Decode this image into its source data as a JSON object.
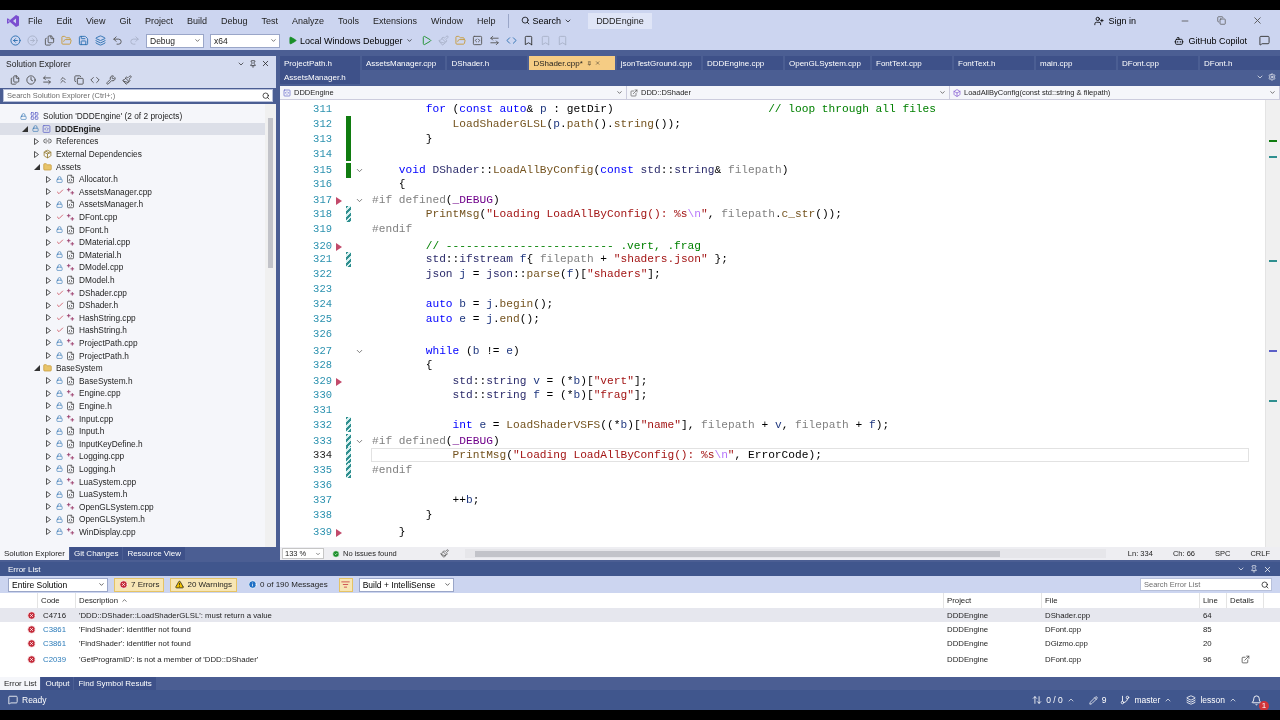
{
  "title_bar": {
    "menu": [
      "File",
      "Edit",
      "View",
      "Git",
      "Project",
      "Build",
      "Debug",
      "Test",
      "Analyze",
      "Tools",
      "Extensions",
      "Window",
      "Help"
    ],
    "search": "Search",
    "project": "DDDEngine",
    "sign_in": "Sign in"
  },
  "toolbar": {
    "configuration": "Debug",
    "platform": "x64",
    "debugger": "Local Windows Debugger",
    "copilot": "GitHub Copilot"
  },
  "solution_explorer": {
    "title": "Solution Explorer",
    "search_placeholder": "Search Solution Explorer (Ctrl+;)",
    "tree": {
      "label": "Solution 'DDDEngine' (2 of 2 projects)",
      "kind": "solution",
      "checked_in": true,
      "selected": false,
      "children": [
        {
          "label": "DDDEngine",
          "kind": "project",
          "checked_in": true,
          "expanded": true,
          "selected": true,
          "children": [
            {
              "label": "References",
              "kind": "references",
              "expanded": false,
              "selected": false
            },
            {
              "label": "External Dependencies",
              "kind": "external",
              "expanded": false,
              "selected": false
            },
            {
              "label": "Assets",
              "kind": "folder",
              "expanded": true,
              "selected": false,
              "children": [
                {
                  "label": "Allocator.h",
                  "kind": "header",
                  "checked_in": true,
                  "expanded": false,
                  "selected": false
                },
                {
                  "label": "AssetsManager.cpp",
                  "kind": "source",
                  "checked_in": false,
                  "expanded": false,
                  "selected": false
                },
                {
                  "label": "AssetsManager.h",
                  "kind": "header",
                  "checked_in": true,
                  "expanded": false,
                  "selected": false
                },
                {
                  "label": "DFont.cpp",
                  "kind": "source",
                  "checked_in": false,
                  "expanded": false,
                  "selected": false
                },
                {
                  "label": "DFont.h",
                  "kind": "header",
                  "checked_in": true,
                  "expanded": false,
                  "selected": false
                },
                {
                  "label": "DMaterial.cpp",
                  "kind": "source",
                  "checked_in": false,
                  "expanded": false,
                  "selected": false
                },
                {
                  "label": "DMaterial.h",
                  "kind": "header",
                  "checked_in": true,
                  "expanded": false,
                  "selected": false
                },
                {
                  "label": "DModel.cpp",
                  "kind": "source",
                  "checked_in": true,
                  "expanded": false,
                  "selected": false
                },
                {
                  "label": "DModel.h",
                  "kind": "header",
                  "checked_in": true,
                  "expanded": false,
                  "selected": false
                },
                {
                  "label": "DShader.cpp",
                  "kind": "source",
                  "checked_in": false,
                  "expanded": false,
                  "selected": false
                },
                {
                  "label": "DShader.h",
                  "kind": "header",
                  "checked_in": false,
                  "expanded": false,
                  "selected": false
                },
                {
                  "label": "HashString.cpp",
                  "kind": "source",
                  "checked_in": false,
                  "expanded": false,
                  "selected": false
                },
                {
                  "label": "HashString.h",
                  "kind": "header",
                  "checked_in": false,
                  "expanded": false,
                  "selected": false
                },
                {
                  "label": "ProjectPath.cpp",
                  "kind": "source",
                  "checked_in": true,
                  "expanded": false,
                  "selected": false
                },
                {
                  "label": "ProjectPath.h",
                  "kind": "header",
                  "checked_in": true,
                  "expanded": false,
                  "selected": false
                }
              ]
            },
            {
              "label": "BaseSystem",
              "kind": "folder",
              "expanded": true,
              "selected": false,
              "children": [
                {
                  "label": "BaseSystem.h",
                  "kind": "header",
                  "checked_in": true,
                  "expanded": false,
                  "selected": false
                },
                {
                  "label": "Engine.cpp",
                  "kind": "source",
                  "checked_in": true,
                  "expanded": false,
                  "selected": false
                },
                {
                  "label": "Engine.h",
                  "kind": "header",
                  "checked_in": true,
                  "expanded": false,
                  "selected": false
                },
                {
                  "label": "Input.cpp",
                  "kind": "source",
                  "checked_in": true,
                  "expanded": false,
                  "selected": false
                },
                {
                  "label": "Input.h",
                  "kind": "header",
                  "checked_in": true,
                  "expanded": false,
                  "selected": false
                },
                {
                  "label": "InputKeyDefine.h",
                  "kind": "header",
                  "checked_in": true,
                  "expanded": false,
                  "selected": false
                },
                {
                  "label": "Logging.cpp",
                  "kind": "source",
                  "checked_in": true,
                  "expanded": false,
                  "selected": false
                },
                {
                  "label": "Logging.h",
                  "kind": "header",
                  "checked_in": true,
                  "expanded": false,
                  "selected": false
                },
                {
                  "label": "LuaSystem.cpp",
                  "kind": "source",
                  "checked_in": true,
                  "expanded": false,
                  "selected": false
                },
                {
                  "label": "LuaSystem.h",
                  "kind": "header",
                  "checked_in": true,
                  "expanded": false,
                  "selected": false
                },
                {
                  "label": "OpenGLSystem.cpp",
                  "kind": "source",
                  "checked_in": true,
                  "expanded": false,
                  "selected": false
                },
                {
                  "label": "OpenGLSystem.h",
                  "kind": "header",
                  "checked_in": true,
                  "expanded": false,
                  "selected": false
                },
                {
                  "label": "WinDisplay.cpp",
                  "kind": "source",
                  "checked_in": true,
                  "expanded": false,
                  "selected": false
                }
              ]
            }
          ]
        }
      ]
    },
    "tabs": [
      {
        "label": "Solution Explorer",
        "selected": true
      },
      {
        "label": "Git Changes",
        "selected": false
      },
      {
        "label": "Resource View",
        "selected": false
      }
    ]
  },
  "editor": {
    "tabs": [
      {
        "label": "ProjectPath.h",
        "selected": false
      },
      {
        "label": "AssetsManager.cpp",
        "selected": false
      },
      {
        "label": "DShader.h",
        "selected": false
      },
      {
        "label": "DShader.cpp*",
        "selected": true
      },
      {
        "label": "jsonTestGround.cpp",
        "selected": false
      },
      {
        "label": "DDDEngine.cpp",
        "selected": false
      },
      {
        "label": "OpenGLSystem.cpp",
        "selected": false
      },
      {
        "label": "FontText.cpp",
        "selected": false
      },
      {
        "label": "FontText.h",
        "selected": false
      },
      {
        "label": "main.cpp",
        "selected": false
      },
      {
        "label": "DFont.cpp",
        "selected": false
      },
      {
        "label": "DFont.h",
        "selected": false
      }
    ],
    "tabs_second_row": [
      {
        "label": "AssetsManager.h",
        "selected": false
      }
    ],
    "navigation": {
      "project": "DDDEngine",
      "scope": "DDD::DShader",
      "member": "LoadAllByConfig(const std::string & filepath)"
    },
    "lines": [
      {
        "number": "311",
        "fold": false,
        "marker": false,
        "current": false,
        "changed": false,
        "segments": [
          {
            "kind": "kw",
            "text": "        for"
          },
          {
            "kind": "plain",
            "text": " ("
          },
          {
            "kind": "kw",
            "text": "const auto"
          },
          {
            "kind": "plain",
            "text": "& "
          },
          {
            "kind": "local",
            "text": "p"
          },
          {
            "kind": "plain",
            "text": " : getDir)                       "
          },
          {
            "kind": "cm",
            "text": "// loop through all files"
          }
        ]
      },
      {
        "number": "312",
        "fold": false,
        "marker": false,
        "current": false,
        "changed": true,
        "saved": true,
        "segments": [
          {
            "kind": "fn",
            "text": "            LoadShaderGLSL"
          },
          {
            "kind": "plain",
            "text": "("
          },
          {
            "kind": "local",
            "text": "p"
          },
          {
            "kind": "plain",
            "text": "."
          },
          {
            "kind": "fn",
            "text": "path"
          },
          {
            "kind": "plain",
            "text": "()."
          },
          {
            "kind": "fn",
            "text": "string"
          },
          {
            "kind": "plain",
            "text": "());"
          }
        ]
      },
      {
        "number": "313",
        "fold": false,
        "marker": false,
        "current": false,
        "changed": true,
        "saved": true,
        "segments": [
          {
            "kind": "plain",
            "text": "        }"
          }
        ]
      },
      {
        "number": "314",
        "fold": false,
        "marker": false,
        "current": false,
        "changed": true,
        "saved": true
      },
      {
        "number": "315",
        "fold": true,
        "marker": false,
        "current": false,
        "changed": true,
        "saved": true,
        "segments": [
          {
            "kind": "kw",
            "text": "    void"
          },
          {
            "kind": "type",
            "text": " DShader"
          },
          {
            "kind": "plain",
            "text": "::"
          },
          {
            "kind": "fn",
            "text": "LoadAllByConfig"
          },
          {
            "kind": "plain",
            "text": "("
          },
          {
            "kind": "kw",
            "text": "const"
          },
          {
            "kind": "type",
            "text": " std"
          },
          {
            "kind": "plain",
            "text": "::"
          },
          {
            "kind": "type",
            "text": "string"
          },
          {
            "kind": "plain",
            "text": "& "
          },
          {
            "kind": "param",
            "text": "filepath"
          },
          {
            "kind": "plain",
            "text": ")"
          }
        ]
      },
      {
        "number": "316",
        "fold": false,
        "marker": false,
        "current": false,
        "changed": false,
        "segments": [
          {
            "kind": "plain",
            "text": "    {"
          }
        ]
      },
      {
        "number": "317",
        "fold": true,
        "marker": true,
        "current": false,
        "changed": false,
        "segments": [
          {
            "kind": "pp",
            "text": "#if defined"
          },
          {
            "kind": "plain",
            "text": "("
          },
          {
            "kind": "macro",
            "text": "_DEBUG"
          },
          {
            "kind": "plain",
            "text": ")"
          }
        ]
      },
      {
        "number": "318",
        "fold": false,
        "marker": false,
        "current": false,
        "changed": true,
        "saved": false,
        "segments": [
          {
            "kind": "fn",
            "text": "        PrintMsg"
          },
          {
            "kind": "plain",
            "text": "("
          },
          {
            "kind": "str",
            "text": "\"Loading LoadAllByConfig(): %s"
          },
          {
            "kind": "esc",
            "text": "\\n"
          },
          {
            "kind": "str",
            "text": "\""
          },
          {
            "kind": "plain",
            "text": ", "
          },
          {
            "kind": "param",
            "text": "filepath"
          },
          {
            "kind": "plain",
            "text": "."
          },
          {
            "kind": "fn",
            "text": "c_str"
          },
          {
            "kind": "plain",
            "text": "());"
          }
        ]
      },
      {
        "number": "319",
        "fold": false,
        "marker": false,
        "current": false,
        "changed": false,
        "segments": [
          {
            "kind": "pp",
            "text": "#endif"
          }
        ]
      },
      {
        "number": "320",
        "fold": false,
        "marker": true,
        "current": false,
        "changed": false,
        "segments": [
          {
            "kind": "cm",
            "text": "        // ------------------------- .vert, .frag"
          }
        ]
      },
      {
        "number": "321",
        "fold": false,
        "marker": false,
        "current": false,
        "changed": true,
        "saved": false,
        "segments": [
          {
            "kind": "type",
            "text": "        std"
          },
          {
            "kind": "plain",
            "text": "::"
          },
          {
            "kind": "type",
            "text": "ifstream"
          },
          {
            "kind": "local",
            "text": " f"
          },
          {
            "kind": "plain",
            "text": "{ "
          },
          {
            "kind": "param",
            "text": "filepath"
          },
          {
            "kind": "plain",
            "text": " + "
          },
          {
            "kind": "str",
            "text": "\"shaders.json\""
          },
          {
            "kind": "plain",
            "text": " };"
          }
        ]
      },
      {
        "number": "322",
        "fold": false,
        "marker": false,
        "current": false,
        "changed": false,
        "segments": [
          {
            "kind": "type",
            "text": "        json"
          },
          {
            "kind": "local",
            "text": " j"
          },
          {
            "kind": "plain",
            "text": " = "
          },
          {
            "kind": "type",
            "text": "json"
          },
          {
            "kind": "plain",
            "text": "::"
          },
          {
            "kind": "fn",
            "text": "parse"
          },
          {
            "kind": "plain",
            "text": "("
          },
          {
            "kind": "local",
            "text": "f"
          },
          {
            "kind": "plain",
            "text": ")["
          },
          {
            "kind": "str",
            "text": "\"shaders\""
          },
          {
            "kind": "plain",
            "text": "];"
          }
        ]
      },
      {
        "number": "323",
        "fold": false,
        "marker": false,
        "current": false,
        "changed": false
      },
      {
        "number": "324",
        "fold": false,
        "marker": false,
        "current": false,
        "changed": false,
        "segments": [
          {
            "kind": "kw",
            "text": "        auto"
          },
          {
            "kind": "local",
            "text": " b"
          },
          {
            "kind": "plain",
            "text": " = "
          },
          {
            "kind": "local",
            "text": "j"
          },
          {
            "kind": "plain",
            "text": "."
          },
          {
            "kind": "fn",
            "text": "begin"
          },
          {
            "kind": "plain",
            "text": "();"
          }
        ]
      },
      {
        "number": "325",
        "fold": false,
        "marker": false,
        "current": false,
        "changed": false,
        "segments": [
          {
            "kind": "kw",
            "text": "        auto"
          },
          {
            "kind": "local",
            "text": " e"
          },
          {
            "kind": "plain",
            "text": " = "
          },
          {
            "kind": "local",
            "text": "j"
          },
          {
            "kind": "plain",
            "text": "."
          },
          {
            "kind": "fn",
            "text": "end"
          },
          {
            "kind": "plain",
            "text": "();"
          }
        ]
      },
      {
        "number": "326",
        "fold": false,
        "marker": false,
        "current": false,
        "changed": false
      },
      {
        "number": "327",
        "fold": true,
        "marker": false,
        "current": false,
        "changed": false,
        "segments": [
          {
            "kind": "kw",
            "text": "        while"
          },
          {
            "kind": "plain",
            "text": " ("
          },
          {
            "kind": "local",
            "text": "b"
          },
          {
            "kind": "plain",
            "text": " != "
          },
          {
            "kind": "local",
            "text": "e"
          },
          {
            "kind": "plain",
            "text": ")"
          }
        ]
      },
      {
        "number": "328",
        "fold": false,
        "marker": false,
        "current": false,
        "changed": false,
        "segments": [
          {
            "kind": "plain",
            "text": "        {"
          }
        ]
      },
      {
        "number": "329",
        "fold": false,
        "marker": true,
        "current": false,
        "changed": false,
        "segments": [
          {
            "kind": "type",
            "text": "            std"
          },
          {
            "kind": "plain",
            "text": "::"
          },
          {
            "kind": "type",
            "text": "string"
          },
          {
            "kind": "local",
            "text": " v"
          },
          {
            "kind": "plain",
            "text": " = (*"
          },
          {
            "kind": "local",
            "text": "b"
          },
          {
            "kind": "plain",
            "text": ")["
          },
          {
            "kind": "str",
            "text": "\"vert\""
          },
          {
            "kind": "plain",
            "text": "];"
          }
        ]
      },
      {
        "number": "330",
        "fold": false,
        "marker": false,
        "current": false,
        "changed": false,
        "segments": [
          {
            "kind": "type",
            "text": "            std"
          },
          {
            "kind": "plain",
            "text": "::"
          },
          {
            "kind": "type",
            "text": "string"
          },
          {
            "kind": "local",
            "text": " f"
          },
          {
            "kind": "plain",
            "text": " = (*"
          },
          {
            "kind": "local",
            "text": "b"
          },
          {
            "kind": "plain",
            "text": ")["
          },
          {
            "kind": "str",
            "text": "\"frag\""
          },
          {
            "kind": "plain",
            "text": "];"
          }
        ]
      },
      {
        "number": "331",
        "fold": false,
        "marker": false,
        "current": false,
        "changed": false
      },
      {
        "number": "332",
        "fold": false,
        "marker": false,
        "current": false,
        "changed": true,
        "saved": false,
        "segments": [
          {
            "kind": "kw",
            "text": "            int"
          },
          {
            "kind": "local",
            "text": " e"
          },
          {
            "kind": "plain",
            "text": " = "
          },
          {
            "kind": "fn",
            "text": "LoadShaderVSFS"
          },
          {
            "kind": "plain",
            "text": "((*"
          },
          {
            "kind": "local",
            "text": "b"
          },
          {
            "kind": "plain",
            "text": ")["
          },
          {
            "kind": "str",
            "text": "\"name\""
          },
          {
            "kind": "plain",
            "text": "], "
          },
          {
            "kind": "param",
            "text": "filepath"
          },
          {
            "kind": "plain",
            "text": " + "
          },
          {
            "kind": "local",
            "text": "v"
          },
          {
            "kind": "plain",
            "text": ", "
          },
          {
            "kind": "param",
            "text": "filepath"
          },
          {
            "kind": "plain",
            "text": " + "
          },
          {
            "kind": "local",
            "text": "f"
          },
          {
            "kind": "plain",
            "text": ");"
          }
        ]
      },
      {
        "number": "333",
        "fold": true,
        "marker": false,
        "current": false,
        "changed": true,
        "saved": false,
        "segments": [
          {
            "kind": "pp",
            "text": "#if defined"
          },
          {
            "kind": "plain",
            "text": "("
          },
          {
            "kind": "macro",
            "text": "_DEBUG"
          },
          {
            "kind": "plain",
            "text": ")"
          }
        ]
      },
      {
        "number": "334",
        "fold": false,
        "marker": false,
        "current": true,
        "changed": true,
        "saved": false,
        "segments": [
          {
            "kind": "fn",
            "text": "            PrintMsg"
          },
          {
            "kind": "plain",
            "text": "("
          },
          {
            "kind": "str",
            "text": "\"Loading LoadAllByConfig(): %s"
          },
          {
            "kind": "esc",
            "text": "\\n"
          },
          {
            "kind": "str",
            "text": "\""
          },
          {
            "kind": "plain",
            "text": ", ErrorCode);"
          }
        ]
      },
      {
        "number": "335",
        "fold": false,
        "marker": false,
        "current": false,
        "changed": true,
        "saved": false,
        "segments": [
          {
            "kind": "pp",
            "text": "#endif"
          }
        ]
      },
      {
        "number": "336",
        "fold": false,
        "marker": false,
        "current": false,
        "changed": false
      },
      {
        "number": "337",
        "fold": false,
        "marker": false,
        "current": false,
        "changed": false,
        "segments": [
          {
            "kind": "plain",
            "text": "            ++"
          },
          {
            "kind": "local",
            "text": "b"
          },
          {
            "kind": "plain",
            "text": ";"
          }
        ]
      },
      {
        "number": "338",
        "fold": false,
        "marker": false,
        "current": false,
        "changed": false,
        "segments": [
          {
            "kind": "plain",
            "text": "        }"
          }
        ]
      },
      {
        "number": "339",
        "fold": false,
        "marker": true,
        "current": false,
        "changed": false,
        "segments": [
          {
            "kind": "plain",
            "text": "    }"
          }
        ]
      }
    ],
    "status": {
      "zoom": "133 %",
      "issues": "No issues found",
      "line": "Ln: 334",
      "column": "Ch: 66",
      "indent": "SPC",
      "line_ending": "CRLF"
    }
  },
  "error_list": {
    "title": "Error List",
    "scope": "Entire Solution",
    "filters": [
      {
        "kind": "errors",
        "label": "7 Errors",
        "on": true
      },
      {
        "kind": "warnings",
        "label": "20 Warnings",
        "on": true
      },
      {
        "kind": "messages",
        "label": "0 of 190 Messages",
        "on": false
      }
    ],
    "source": "Build + IntelliSense",
    "search_placeholder": "Search Error List",
    "columns": [
      {
        "label": "Code",
        "sorted": false
      },
      {
        "label": "Description",
        "sorted": true
      },
      {
        "label": "Project",
        "sorted": false
      },
      {
        "label": "File",
        "sorted": false
      },
      {
        "label": "Line",
        "sorted": false
      },
      {
        "label": "Details",
        "sorted": false
      }
    ],
    "rows": [
      {
        "code": "C4716",
        "link": false,
        "description": "'DDD::DShader::LoadShaderGLSL': must return a value",
        "project": "DDDEngine",
        "file": "DShader.cpp",
        "line": "64",
        "details": false,
        "selected": true
      },
      {
        "code": "C3861",
        "link": true,
        "description": "'FindShader': identifier not found",
        "project": "DDDEngine",
        "file": "DFont.cpp",
        "line": "85",
        "details": false,
        "selected": false
      },
      {
        "code": "C3861",
        "link": true,
        "description": "'FindShader': identifier not found",
        "project": "DDDEngine",
        "file": "DGizmo.cpp",
        "line": "20",
        "details": false,
        "selected": false
      },
      {
        "code": "C2039",
        "link": true,
        "description": "'GetProgramID': is not a member of 'DDD::DShader'",
        "project": "DDDEngine",
        "file": "DFont.cpp",
        "line": "96",
        "details": true,
        "selected": false
      }
    ],
    "tabs": [
      {
        "label": "Error List",
        "selected": true
      },
      {
        "label": "Output",
        "selected": false
      },
      {
        "label": "Find Symbol Results",
        "selected": false
      }
    ]
  },
  "status_bar": {
    "message": "Ready",
    "sync": "0 / 0",
    "changes": "9",
    "branch": "master",
    "repository": "lesson",
    "notifications": "1"
  }
}
